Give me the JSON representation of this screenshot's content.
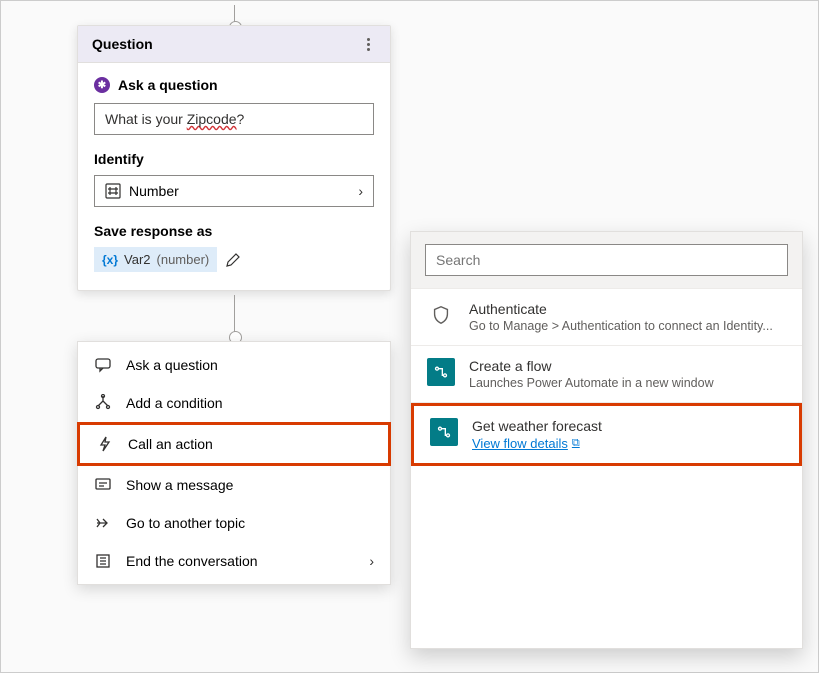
{
  "question_card": {
    "header_title": "Question",
    "ask_label": "Ask a question",
    "input_pre": "What is your ",
    "input_wavy": "Zipcode",
    "input_post": "?",
    "identify_label": "Identify",
    "identify_value": "Number",
    "save_label": "Save response as",
    "var_name": "Var2",
    "var_type": "(number)"
  },
  "action_menu": {
    "items": [
      {
        "label": "Ask a question"
      },
      {
        "label": "Add a condition"
      },
      {
        "label": "Call an action"
      },
      {
        "label": "Show a message"
      },
      {
        "label": "Go to another topic"
      },
      {
        "label": "End the conversation"
      }
    ]
  },
  "flyout": {
    "search_placeholder": "Search",
    "authenticate": {
      "title": "Authenticate",
      "subtitle": "Go to Manage > Authentication to connect an Identity..."
    },
    "create_flow": {
      "title": "Create a flow",
      "subtitle": "Launches Power Automate in a new window"
    },
    "weather": {
      "title": "Get weather forecast",
      "link": "View flow details"
    }
  }
}
